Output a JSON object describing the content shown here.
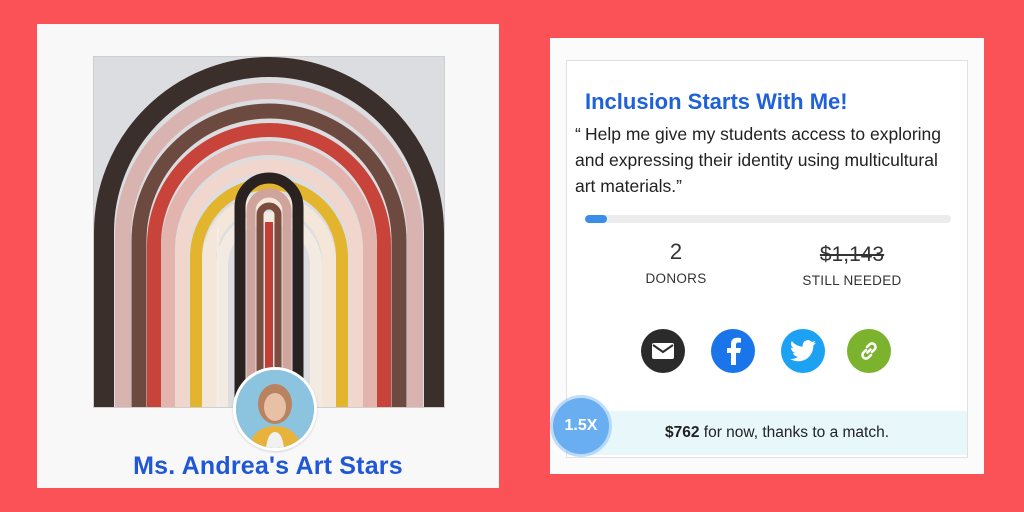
{
  "left_card": {
    "teacher_name": "Ms. Andrea's Art Stars",
    "artwork": "rainbow-arch-painting",
    "avatar": "teacher-avatar"
  },
  "project": {
    "title": "Inclusion Starts With Me!",
    "quote_open": "“",
    "quote": "Help me give my students access to exploring and expressing their identity using multicultural art materials.”",
    "progress_fraction": 0.06,
    "donors": {
      "value": "2",
      "label": "DONORS"
    },
    "still_needed": {
      "value": "$1,143",
      "label": "STILL NEEDED"
    },
    "share_icons": [
      "email-icon",
      "facebook-icon",
      "twitter-icon",
      "link-icon"
    ],
    "match": {
      "badge": "1.5X",
      "amount": "$762",
      "text": " for now, thanks to a match."
    }
  },
  "colors": {
    "background": "#fb5257",
    "title_blue": "#1f61d9",
    "name_blue": "#1f57d6",
    "progress": "#3b8ee8",
    "match_bar": "#e8f8fa"
  }
}
